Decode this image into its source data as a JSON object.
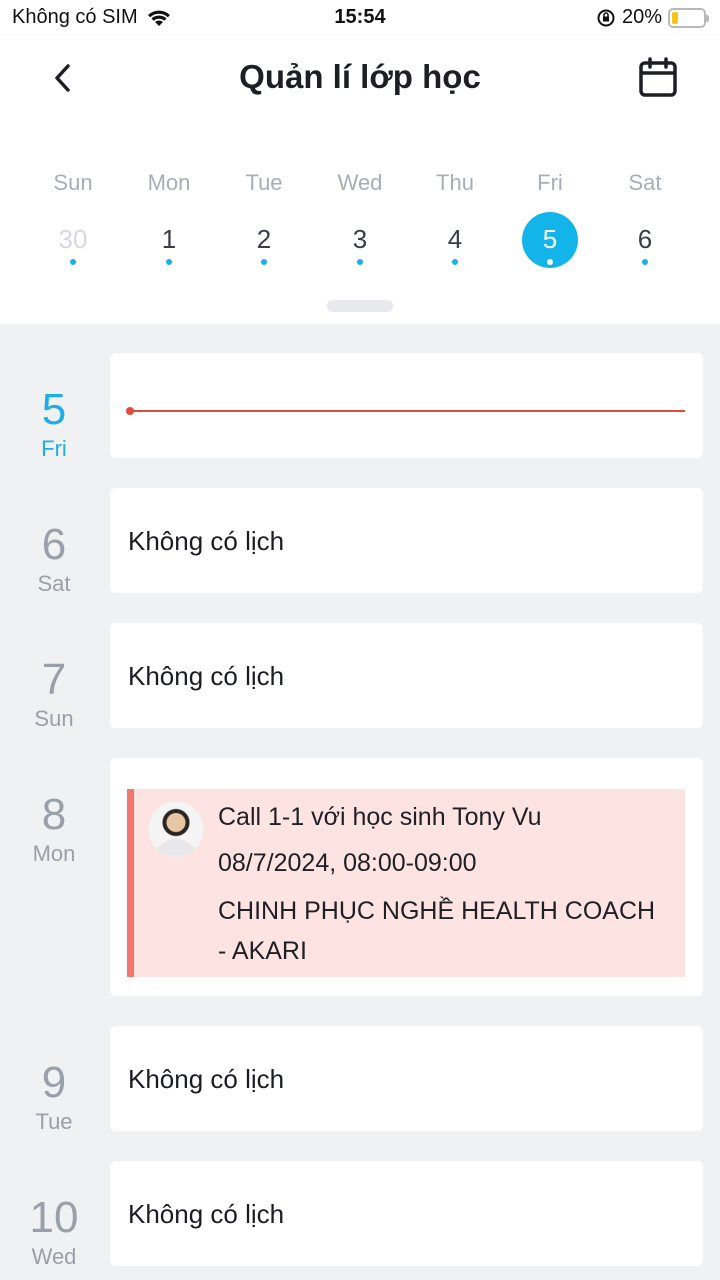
{
  "status_bar": {
    "carrier": "Không có SIM",
    "time": "15:54",
    "battery": "20%",
    "battery_level": 0.2
  },
  "header": {
    "title": "Quản lí lớp học"
  },
  "week": {
    "days": [
      {
        "name": "Sun",
        "num": "30"
      },
      {
        "name": "Mon",
        "num": "1"
      },
      {
        "name": "Tue",
        "num": "2"
      },
      {
        "name": "Wed",
        "num": "3"
      },
      {
        "name": "Thu",
        "num": "4"
      },
      {
        "name": "Fri",
        "num": "5"
      },
      {
        "name": "Sat",
        "num": "6"
      }
    ]
  },
  "agenda": {
    "rows": [
      {
        "num": "5",
        "weekday": "Fri"
      },
      {
        "num": "6",
        "weekday": "Sat",
        "text": "Không có lịch"
      },
      {
        "num": "7",
        "weekday": "Sun",
        "text": "Không có lịch"
      },
      {
        "num": "8",
        "weekday": "Mon"
      },
      {
        "num": "9",
        "weekday": "Tue",
        "text": "Không có lịch"
      },
      {
        "num": "10",
        "weekday": "Wed",
        "text": "Không có lịch"
      }
    ],
    "event": {
      "title": "Call 1-1 với học sinh Tony Vu",
      "datetime": "08/7/2024, 08:00-09:00",
      "course_line1": "CHINH PHỤC NGHỀ HEALTH COACH",
      "course_line2": "- AKARI"
    }
  },
  "colors": {
    "accent": "#13b4ea",
    "now_line": "#e64a3c",
    "event_bg": "#fde3e2",
    "event_bar": "#f3766c"
  }
}
